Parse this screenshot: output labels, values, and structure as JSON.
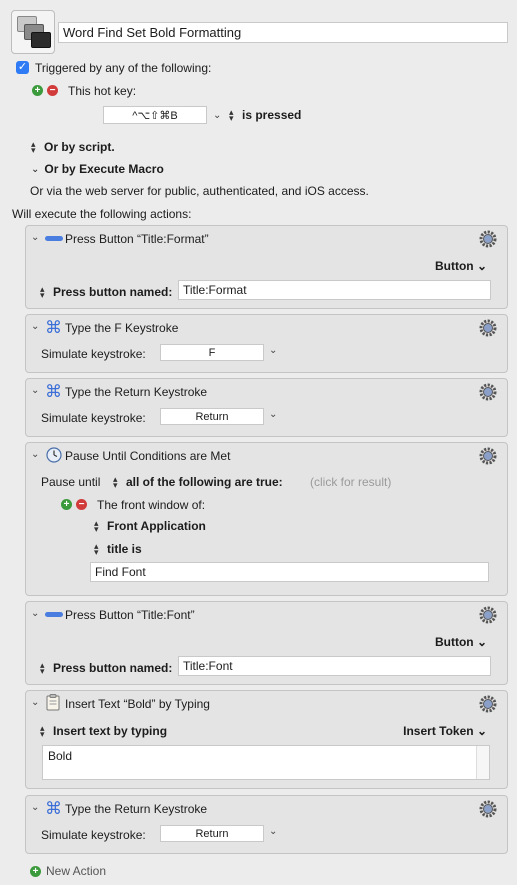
{
  "macro": {
    "name": "Word Find Set Bold Formatting",
    "triggered_label": "Triggered by any of the following:",
    "hotkey_label": "This hot key:",
    "hotkey_value": "^⌥⇧⌘B",
    "hotkey_condition": "is pressed",
    "or_by_script": "Or by script.",
    "or_by_execute_macro": "Or by Execute Macro",
    "web_server_text": "Or via the web server for public, authenticated, and iOS access.",
    "will_execute": "Will execute the following actions:",
    "new_action": "New Action"
  },
  "actions": [
    {
      "title": "Press Button “Title:Format”",
      "mode": "Button",
      "field_label": "Press button named:",
      "field_value": "Title:Format"
    },
    {
      "title": "Type the F Keystroke",
      "field_label": "Simulate keystroke:",
      "field_value": "F"
    },
    {
      "title": "Type the Return Keystroke",
      "field_label": "Simulate keystroke:",
      "field_value": "Return"
    },
    {
      "title": "Pause Until Conditions are Met",
      "pause_until": "Pause until",
      "condition_mode": "all of the following are true:",
      "click_hint": "(click for result)",
      "front_window": "The front window of:",
      "front_app": "Front Application",
      "title_is": "title is",
      "title_value": "Find Font"
    },
    {
      "title": "Press Button “Title:Font”",
      "mode": "Button",
      "field_label": "Press button named:",
      "field_value": "Title:Font"
    },
    {
      "title": "Insert Text “Bold” by Typing",
      "insert_mode": "Insert text by typing",
      "insert_token": "Insert Token",
      "text_value": "Bold"
    },
    {
      "title": "Type the Return Keystroke",
      "field_label": "Simulate keystroke:",
      "field_value": "Return"
    }
  ],
  "colors": {
    "checkbox": "#2f7bf5",
    "green": "#3b9a3b",
    "red": "#d23b3b"
  }
}
